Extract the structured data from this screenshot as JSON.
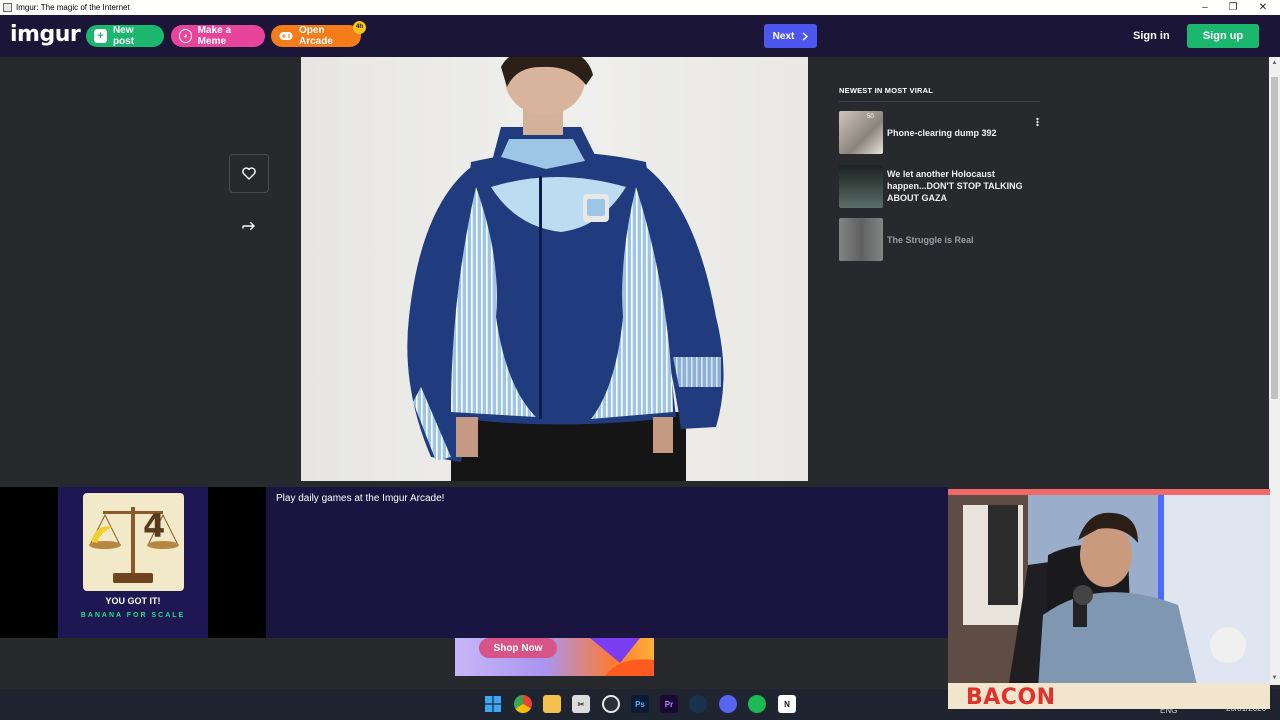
{
  "window": {
    "title": "Imgur: The magic of the Internet",
    "controls": [
      "–",
      "❐",
      "✕"
    ]
  },
  "nav": {
    "logo": "imgur",
    "new_post": "New post",
    "make_meme": "Make a Meme",
    "open_arcade": "Open Arcade",
    "arcade_badge": "4h",
    "next": "Next",
    "sign_in": "Sign in",
    "sign_up": "Sign up"
  },
  "sidebar": {
    "title": "NEWEST IN MOST VIRAL",
    "items": [
      {
        "title": "Phone-clearing dump 392",
        "count": "50"
      },
      {
        "title": "We let another Holocaust happen...DON'T STOP TALKING ABOUT GAZA"
      },
      {
        "title": "The Struggle is Real"
      }
    ]
  },
  "arcade": {
    "message": "Play daily games at the Imgur Arcade!",
    "game_number": "4",
    "result": "YOU GOT IT!",
    "answer": "BANANA FOR SCALE"
  },
  "ad": {
    "button": "Shop Now"
  },
  "webcam": {
    "caption": "BACON"
  },
  "taskbar": {
    "date": "28/01/2026",
    "lang": "ENG"
  },
  "colors": {
    "nav_bg": "#1b1537",
    "page_bg": "#27292d",
    "green": "#1bb76e",
    "pink": "#e8449b",
    "orange": "#f47c1b",
    "next_blue": "#4d57f0"
  }
}
